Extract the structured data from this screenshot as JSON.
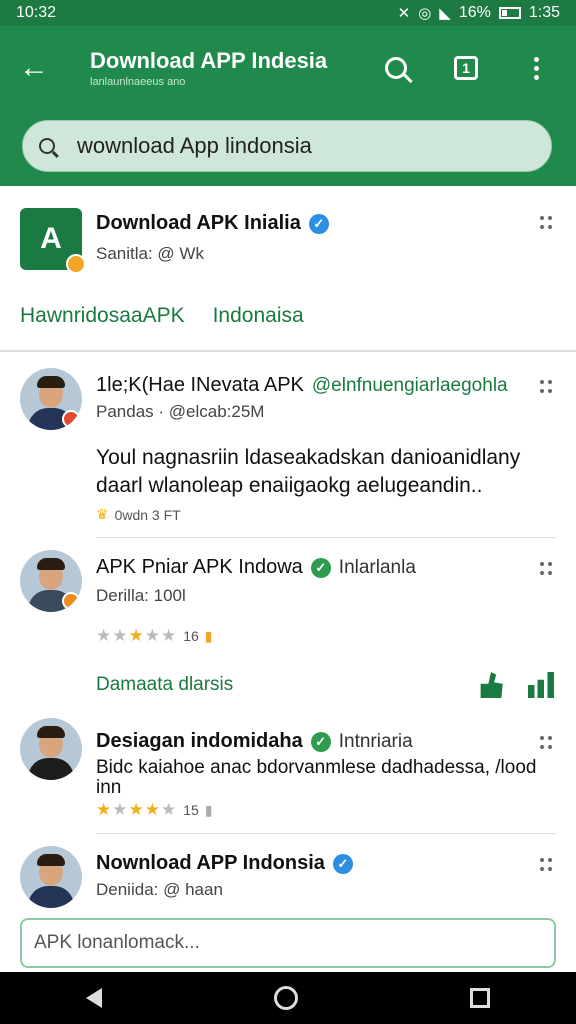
{
  "status": {
    "time_left": "10:32",
    "battery": "16%",
    "time_right": "1:35"
  },
  "appbar": {
    "title": "Download APP Indesia",
    "subtitle": "lanlaunlnaeeus ano",
    "tab_count": "1"
  },
  "search": {
    "query": "wownload App lindonsia"
  },
  "app_card": {
    "name": "Download APK Inialia",
    "sub": "Sanitla: @ Wk",
    "logo_text": "A",
    "tabs": [
      "HawnridosaaAPK",
      "Indonaisa"
    ]
  },
  "posts": [
    {
      "name": "1le;K(Hae INevata APK",
      "handle": "@elnfnuengiarlaegohla",
      "sub": "Pandas · @elcab:25M",
      "body": "Youl nagnasriin ldaseakadskan danioanidlany daarl wlanoleap enaiigaokg aelugeandin..",
      "meta": "0wdn  3 FT"
    },
    {
      "name": "APK Pniar APK Indowa",
      "extra": "Inlarlanla",
      "sub": "Derilla: 100l",
      "rating_count": "16",
      "reply_label": "Damaata dlarsis"
    },
    {
      "name": "Desiagan indomidaha",
      "extra": "Intnriaria",
      "body": "Bidc kaiahoe anac bdorvanmlese dadhadessa, /lood inn",
      "rating_count": "15"
    },
    {
      "name": "Nownload APP Indonsia",
      "sub": "Deniida: @ haan"
    }
  ],
  "compose": {
    "placeholder": "APK lonanlomack..."
  },
  "colors": {
    "primary": "#1f8a4c",
    "accent": "#1a7a42",
    "verified_blue": "#2d8fe3",
    "star": "#f2b01e"
  }
}
